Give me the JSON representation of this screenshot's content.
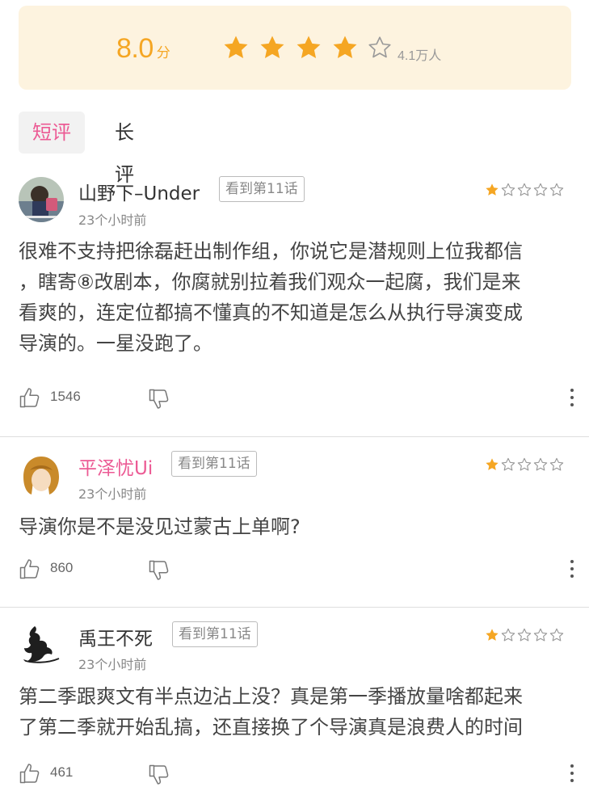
{
  "rating": {
    "score": "8.0",
    "score_unit": "分",
    "filled_stars": 4,
    "total_stars": 5,
    "count": "4.1万人",
    "accent_color": "#f5a623",
    "card_background": "#fdf3df"
  },
  "tabs": [
    {
      "label": "短评",
      "active": true
    },
    {
      "label": "长评",
      "active": false
    }
  ],
  "comments": [
    {
      "username": "山野下–Under",
      "username_color": "#333333",
      "progress_badge": "看到第11话",
      "time": "23个小时前",
      "stars": 1,
      "text_lines": [
        "很难不支持把徐磊赶出制作组，你说它是潜规则上位我都信",
        "，瞎寄⑧改剧本，你腐就别拉着我们观众一起腐，我们是来",
        "看爽的，连定位都搞不懂真的不知道是怎么从执行导演变成",
        "导演的。一星没跑了。"
      ],
      "likes": "1546"
    },
    {
      "username": "平泽忧Ui",
      "username_color": "#ec5a94",
      "progress_badge": "看到第11话",
      "time": "23个小时前",
      "stars": 1,
      "text_lines": [
        "导演你是不是没见过蒙古上单啊?"
      ],
      "likes": "860"
    },
    {
      "username": "禹王不死",
      "username_color": "#333333",
      "progress_badge": "看到第11话",
      "time": "23个小时前",
      "stars": 1,
      "text_lines": [
        "第二季跟爽文有半点边沾上没？真是第一季播放量啥都起来",
        "了第二季就开始乱搞，还直接换了个导演真是浪费人的时间"
      ],
      "likes": "461"
    }
  ],
  "icons": {
    "rating_star": "star-icon",
    "like": "thumbs-up-icon",
    "dislike": "thumbs-down-icon",
    "more": "more-vertical-icon"
  }
}
